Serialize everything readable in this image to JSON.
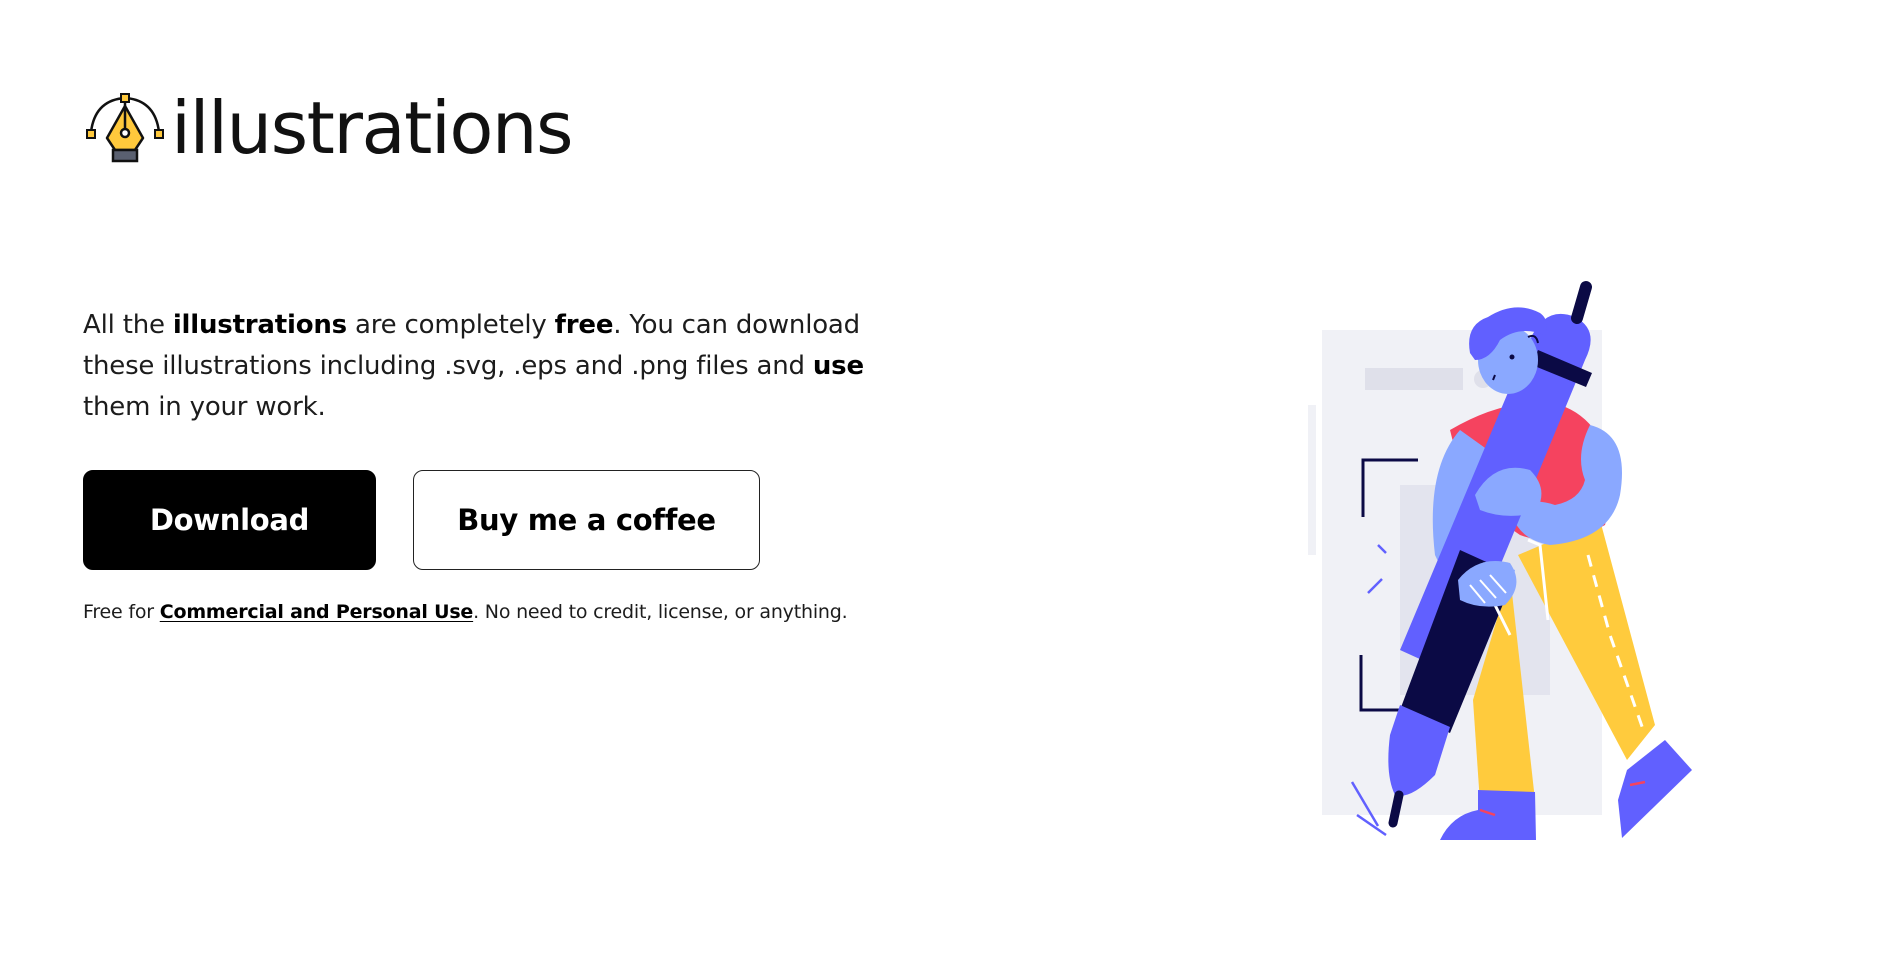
{
  "logo": {
    "icon": "pen-tool-icon",
    "text": "illustrations"
  },
  "hero": {
    "text_parts": {
      "p1": "All the ",
      "b1": "illustrations",
      "p2": " are completely ",
      "b2": "free",
      "p3": ". You can download these illustrations including .svg, .eps and .png files and ",
      "b3": "use",
      "p4": " them in your work."
    }
  },
  "buttons": {
    "download_label": "Download",
    "coffee_label": "Buy me a coffee"
  },
  "note": {
    "prefix": "Free for ",
    "link": "Commercial and Personal Use",
    "suffix": ". No need to credit, license, or anything."
  },
  "illustration": {
    "name": "person-holding-pen-illustration",
    "colors": {
      "accent_purple": "#6160ff",
      "skin_blue": "#8aa8ff",
      "shirt_red": "#f5435f",
      "pants_yellow": "#ffcb3d",
      "navy": "#0b0a45",
      "bg_gray": "#f0f1f6"
    }
  }
}
